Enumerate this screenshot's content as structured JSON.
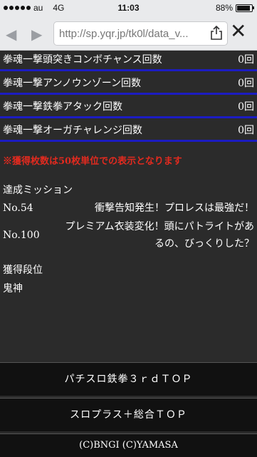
{
  "status": {
    "carrier": "au",
    "network": "4G",
    "time": "11:03",
    "battery": "88%",
    "battery_level": 0.88
  },
  "browser": {
    "url": "http://sp.yqr.jp/tk0l/data_v..."
  },
  "stats": [
    {
      "label": "拳魂一撃頭突きコンボチャンス回数",
      "value": "0回"
    },
    {
      "label": "拳魂一撃アンノウンゾーン回数",
      "value": "0回"
    },
    {
      "label": "拳魂一撃鉄拳アタック回数",
      "value": "0回"
    },
    {
      "label": "拳魂一撃オーガチャレンジ回数",
      "value": "0回"
    }
  ],
  "notice": "※獲得枚数は50枚単位での表示となります",
  "missions": {
    "title": "達成ミッション",
    "items": [
      {
        "no": "No.54",
        "text": "衝撃告知発生！プロレスは最強だ！"
      },
      {
        "no": "No.100",
        "text": "プレミアム衣装変化！頭にパトライトがあるの、びっくりした？"
      }
    ]
  },
  "rank": {
    "title": "獲得段位",
    "value": "鬼神"
  },
  "buttons": {
    "top": "パチスロ鉄拳３ｒｄＴＯＰ",
    "slo": "スロプラス＋総合ＴＯＰ"
  },
  "footer": "(C)BNGI (C)YAMASA"
}
